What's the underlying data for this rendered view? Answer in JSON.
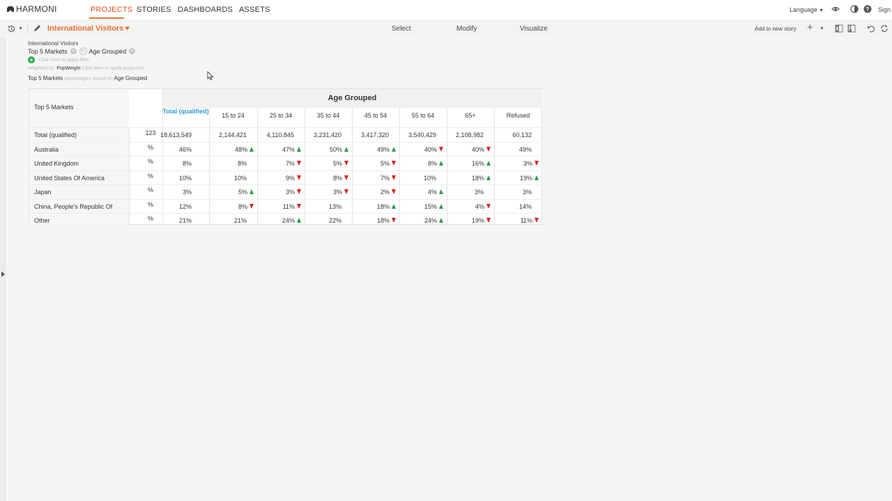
{
  "nav": {
    "brand": "HARMONI",
    "links": [
      "PROJECTS",
      "STORIES",
      "DASHBOARDS",
      "ASSETS"
    ],
    "language": "Language",
    "signin": "Sign"
  },
  "toolbar": {
    "project_title": "International Visitors",
    "modes": [
      "Select",
      "Modify",
      "Visualize"
    ],
    "add_to_story": "Add to new story"
  },
  "summary": {
    "title": "International Visitors",
    "row_var": "Top 5 Markets",
    "col_var": "Age Grouped",
    "filter_hint": "Click here to apply filter",
    "weight_prefix": "weighted by:",
    "weight": "PopWeight",
    "projection_hint": "Click here to apply projection",
    "basis_row": "Top 5 Markets",
    "basis_mid": "percentages based on",
    "basis_col": "Age Grouped"
  },
  "table": {
    "row_header": "Top 5 Markets",
    "group_header": "Age Grouped",
    "columns": [
      "Total (qualified)",
      "15 to 24",
      "25 to 34",
      "35 to 44",
      "45 to 54",
      "55 to 64",
      "65+",
      "Refused"
    ],
    "rows": [
      {
        "label": "Total (qualified)",
        "unit": "123",
        "cells": [
          {
            "v": "18,613,549",
            "a": ""
          },
          {
            "v": "2,144,421",
            "a": ""
          },
          {
            "v": "4,110,845",
            "a": ""
          },
          {
            "v": "3,231,420",
            "a": ""
          },
          {
            "v": "3,417,320",
            "a": ""
          },
          {
            "v": "3,540,429",
            "a": ""
          },
          {
            "v": "2,108,982",
            "a": ""
          },
          {
            "v": "60,132",
            "a": ""
          }
        ]
      },
      {
        "label": "Australia",
        "unit": "%",
        "cells": [
          {
            "v": "46%",
            "a": ""
          },
          {
            "v": "48%",
            "a": "up"
          },
          {
            "v": "47%",
            "a": "up"
          },
          {
            "v": "50%",
            "a": "up"
          },
          {
            "v": "49%",
            "a": "up"
          },
          {
            "v": "40%",
            "a": "down"
          },
          {
            "v": "40%",
            "a": "down"
          },
          {
            "v": "49%",
            "a": ""
          }
        ]
      },
      {
        "label": "United Kingdom",
        "unit": "%",
        "cells": [
          {
            "v": "8%",
            "a": ""
          },
          {
            "v": "8%",
            "a": ""
          },
          {
            "v": "7%",
            "a": "down"
          },
          {
            "v": "5%",
            "a": "down"
          },
          {
            "v": "5%",
            "a": "down"
          },
          {
            "v": "8%",
            "a": "up"
          },
          {
            "v": "16%",
            "a": "up"
          },
          {
            "v": "3%",
            "a": "down"
          }
        ]
      },
      {
        "label": "United States Of America",
        "unit": "%",
        "cells": [
          {
            "v": "10%",
            "a": ""
          },
          {
            "v": "10%",
            "a": ""
          },
          {
            "v": "9%",
            "a": "down"
          },
          {
            "v": "8%",
            "a": "down"
          },
          {
            "v": "7%",
            "a": "down"
          },
          {
            "v": "10%",
            "a": ""
          },
          {
            "v": "18%",
            "a": "up"
          },
          {
            "v": "19%",
            "a": "up"
          }
        ]
      },
      {
        "label": "Japan",
        "unit": "%",
        "cells": [
          {
            "v": "3%",
            "a": ""
          },
          {
            "v": "5%",
            "a": "up"
          },
          {
            "v": "3%",
            "a": "down"
          },
          {
            "v": "3%",
            "a": "down"
          },
          {
            "v": "2%",
            "a": "down"
          },
          {
            "v": "4%",
            "a": "up"
          },
          {
            "v": "3%",
            "a": ""
          },
          {
            "v": "3%",
            "a": ""
          }
        ]
      },
      {
        "label": "China, People's Republic Of",
        "unit": "%",
        "cells": [
          {
            "v": "12%",
            "a": ""
          },
          {
            "v": "8%",
            "a": "down"
          },
          {
            "v": "11%",
            "a": "down"
          },
          {
            "v": "13%",
            "a": ""
          },
          {
            "v": "18%",
            "a": "up"
          },
          {
            "v": "15%",
            "a": "up"
          },
          {
            "v": "4%",
            "a": "down"
          },
          {
            "v": "14%",
            "a": ""
          }
        ]
      },
      {
        "label": "Other",
        "unit": "%",
        "cells": [
          {
            "v": "21%",
            "a": ""
          },
          {
            "v": "21%",
            "a": ""
          },
          {
            "v": "24%",
            "a": "up"
          },
          {
            "v": "22%",
            "a": ""
          },
          {
            "v": "18%",
            "a": "down"
          },
          {
            "v": "24%",
            "a": "up"
          },
          {
            "v": "19%",
            "a": "down"
          },
          {
            "v": "11%",
            "a": "down"
          }
        ]
      }
    ]
  },
  "colors": {
    "accent": "#e9712f",
    "total_header": "#2b9ad6",
    "up": "#27a046",
    "down": "#e02020"
  }
}
